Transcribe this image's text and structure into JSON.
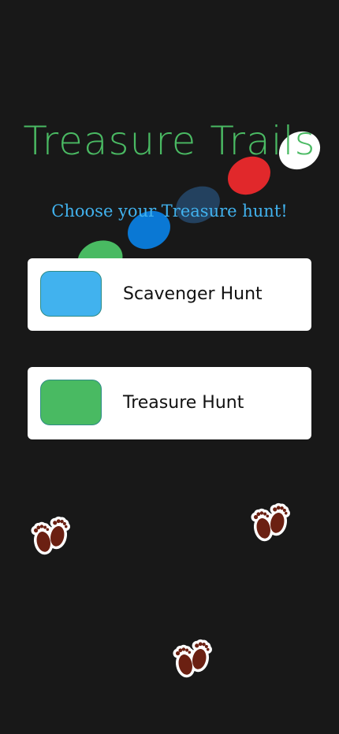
{
  "app": {
    "title": "Treasure Trails",
    "subtitle": "Choose your Treasure hunt!"
  },
  "decor": {
    "path_dots": [
      {
        "name": "green-dot",
        "color": "#49ba62"
      },
      {
        "name": "blue-dot",
        "color": "#0a78d4"
      },
      {
        "name": "navy-dot",
        "color": "#23415f"
      },
      {
        "name": "red-dot",
        "color": "#e1282b"
      },
      {
        "name": "white-dot",
        "color": "#ffffff"
      }
    ],
    "footprint_icon": "footprints-icon"
  },
  "hunts": [
    {
      "label": "Scavenger Hunt",
      "color": "#41b2ee"
    },
    {
      "label": "Treasure Hunt",
      "color": "#49ba62"
    }
  ],
  "colors": {
    "background": "#181818",
    "title": "#4aba63",
    "subtitle": "#41b2ee",
    "card": "#ffffff",
    "footprint": "#6b2012"
  }
}
